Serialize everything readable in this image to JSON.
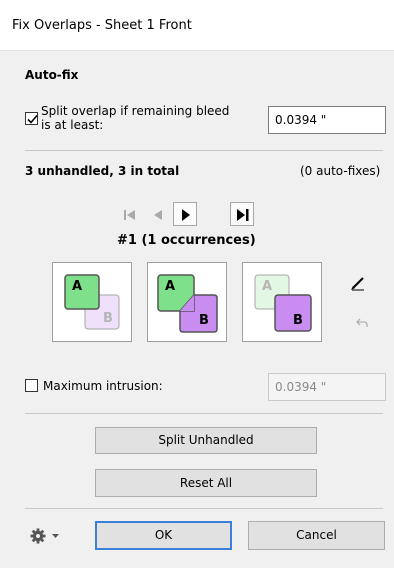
{
  "window": {
    "title": "Fix Overlaps - Sheet 1 Front"
  },
  "autofix": {
    "heading": "Auto-fix",
    "split_label_line1": "Split overlap if remaining bleed",
    "split_label_line2": "is at least:",
    "split_checked": true,
    "split_value": "0.0394 \""
  },
  "summary": {
    "status": "3 unhandled, 3 in total",
    "autofixes": "(0 auto-fixes)"
  },
  "navigator": {
    "current": "#1 (1 occurrences)",
    "buttons": [
      "first-icon",
      "previous-icon",
      "next-icon",
      "last-icon"
    ]
  },
  "options": {
    "tiles": [
      {
        "label_a": "A",
        "label_b": "B",
        "name": "keep-a-on-top"
      },
      {
        "label_a": "A",
        "label_b": "B",
        "name": "split-overlap"
      },
      {
        "label_a": "A",
        "label_b": "B",
        "name": "keep-b-on-top"
      }
    ],
    "tools": [
      "edit-pen-icon",
      "undo-icon"
    ],
    "colors": {
      "green": "#7ee08b",
      "purple": "#c98cf0",
      "border": "#555555"
    }
  },
  "intrusion": {
    "label": "Maximum intrusion:",
    "checked": false,
    "value": "0.0394 \""
  },
  "actions": {
    "split_unhandled": "Split Unhandled",
    "reset_all": "Reset All"
  },
  "footer": {
    "settings_icon": "gear-icon",
    "ok": "OK",
    "cancel": "Cancel"
  }
}
